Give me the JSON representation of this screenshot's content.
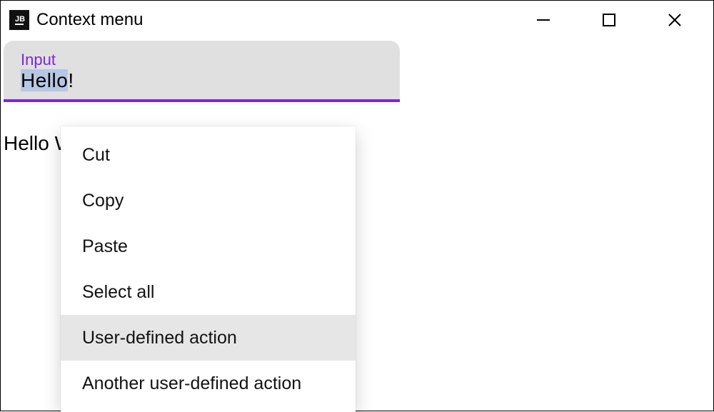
{
  "window": {
    "title": "Context menu"
  },
  "input": {
    "label": "Input",
    "selected_prefix": "Hello",
    "suffix": "!"
  },
  "output": {
    "text": "Hello W"
  },
  "context_menu": {
    "items": [
      {
        "label": "Cut",
        "hover": false
      },
      {
        "label": "Copy",
        "hover": false
      },
      {
        "label": "Paste",
        "hover": false
      },
      {
        "label": "Select all",
        "hover": false
      },
      {
        "label": "User-defined action",
        "hover": true
      },
      {
        "label": "Another user-defined action",
        "hover": false
      }
    ]
  },
  "colors": {
    "accent": "#7a28d6"
  }
}
